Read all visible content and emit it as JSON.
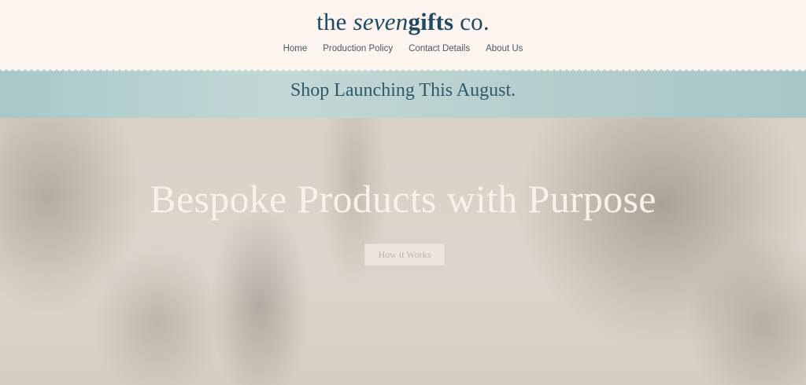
{
  "logo": {
    "part1": "the ",
    "part2": "seven",
    "part3": "gifts",
    "part4": " co."
  },
  "nav": {
    "items": [
      {
        "label": "Home"
      },
      {
        "label": "Production Policy"
      },
      {
        "label": "Contact Details"
      },
      {
        "label": "About Us"
      }
    ]
  },
  "banner": {
    "text": "Shop Launching This August."
  },
  "hero": {
    "title": "Bespoke Products with Purpose",
    "button_label": "How it Works"
  },
  "colors": {
    "brand_navy": "#1f4a63",
    "banner_teal": "#b4cdcc",
    "banner_text": "#2f5968",
    "page_bg": "#fbf4ef"
  }
}
